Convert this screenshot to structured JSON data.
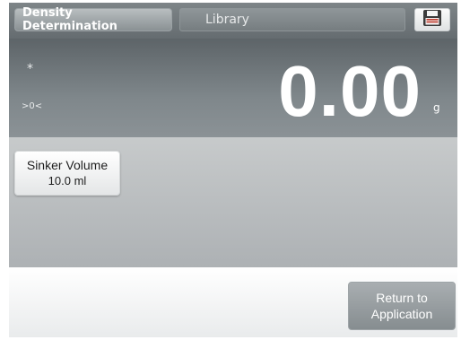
{
  "header": {
    "app_tab_label": "Density Determination",
    "library_label": "Library",
    "save_icon": "floppy-disk-icon"
  },
  "display": {
    "stable_indicator": "*",
    "zero_indicator": ">0<",
    "weight_value": "0.00",
    "unit": "g"
  },
  "info": {
    "sinker_volume_label": "Sinker Volume",
    "sinker_volume_value": "10.0 ml"
  },
  "footer": {
    "return_line1": "Return to",
    "return_line2": "Application"
  },
  "colors": {
    "header_bg": "#6f7679",
    "display_bg": "#727a7e",
    "info_bg": "#bcbfc1",
    "save_icon_red": "#c0392b"
  }
}
